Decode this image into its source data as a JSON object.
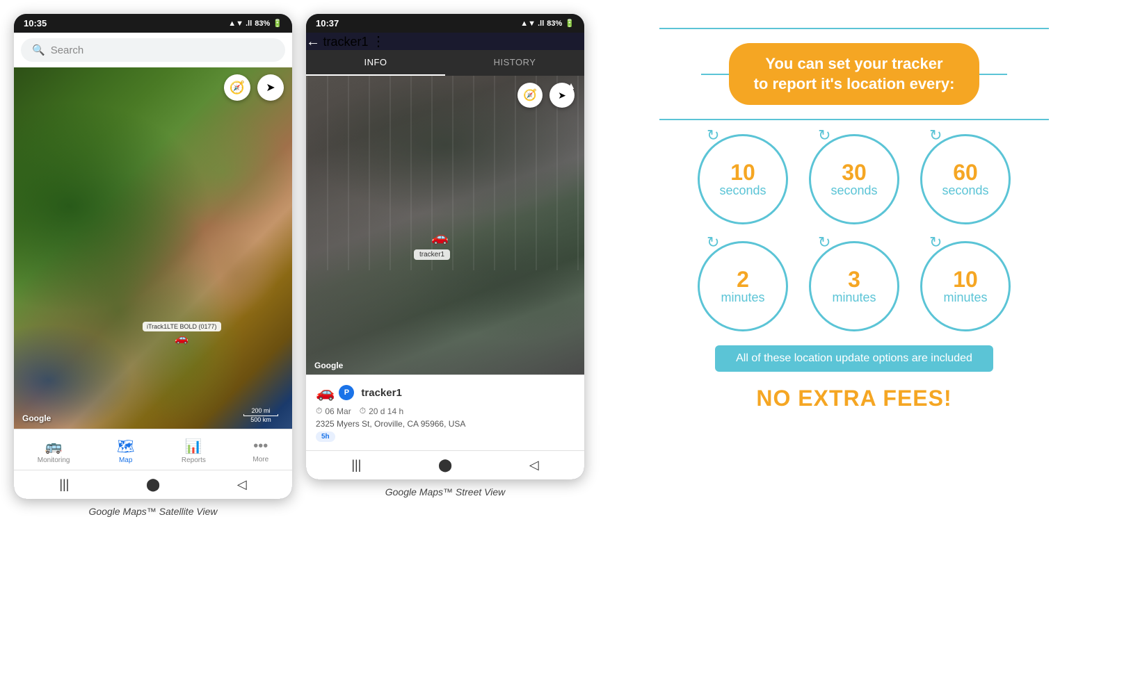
{
  "phone1": {
    "statusBar": {
      "time": "10:35",
      "signal": "▲▼",
      "bars": "..ll",
      "battery": "83%",
      "batteryIcon": "🔋"
    },
    "searchPlaceholder": "Search",
    "compassSymbol": "🧭",
    "locationSymbol": "➤",
    "trackerLabel": "iTrack1LTE BOLD (0177)",
    "googleLogo": "Google",
    "scaleBar": {
      "imperial": "200 mi",
      "metric": "500 km"
    },
    "nav": {
      "items": [
        {
          "icon": "🚌",
          "label": "Monitoring",
          "active": false
        },
        {
          "icon": "🗺",
          "label": "Map",
          "active": true
        },
        {
          "icon": "📊",
          "label": "Reports",
          "active": false
        },
        {
          "icon": "•••",
          "label": "More",
          "active": false
        }
      ]
    },
    "caption": "Google Maps™ Satellite View"
  },
  "phone2": {
    "statusBar": {
      "time": "10:37",
      "signal": "▲▼",
      "bars": "..ll",
      "battery": "83%",
      "batteryIcon": "🔋"
    },
    "header": {
      "backBtn": "←",
      "trackerName": "tracker1",
      "moreBtn": "⋮"
    },
    "tabs": [
      {
        "label": "INFO",
        "active": true
      },
      {
        "label": "HISTORY",
        "active": false
      }
    ],
    "compassSymbol": "🧭",
    "locationSymbol": "➤",
    "trackerLabel": "tracker1",
    "googleLogo": "Google",
    "trackerInfo": {
      "trackerName": "tracker1",
      "pBadge": "P",
      "date": "06 Mar",
      "duration": "20 d 14 h",
      "address": "2325 Myers St, Oroville, CA 95966, USA",
      "updateBadge": "5h"
    },
    "caption": "Google Maps™ Street View"
  },
  "infoGraphic": {
    "headline": "You can set your tracker\nto report it's location every:",
    "circles": [
      {
        "row": 1,
        "items": [
          {
            "number": "10",
            "unit": "seconds"
          },
          {
            "number": "30",
            "unit": "seconds"
          },
          {
            "number": "60",
            "unit": "seconds"
          }
        ]
      },
      {
        "row": 2,
        "items": [
          {
            "number": "2",
            "unit": "minutes"
          },
          {
            "number": "3",
            "unit": "minutes"
          },
          {
            "number": "10",
            "unit": "minutes"
          }
        ]
      }
    ],
    "noFeesText": "All of these location update options are included",
    "noExtraFees": "NO EXTRA FEES!"
  }
}
